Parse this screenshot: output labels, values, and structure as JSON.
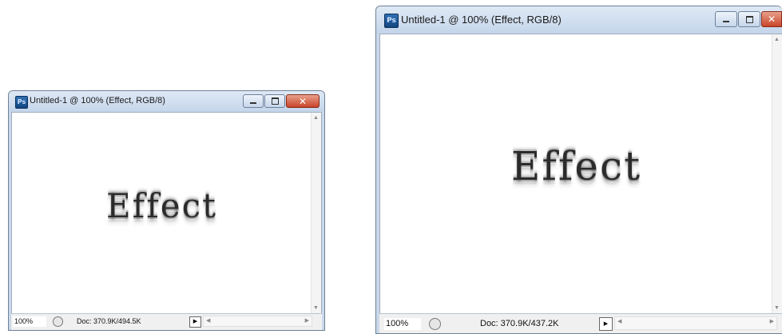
{
  "windows": [
    {
      "title": "Untitled-1 @ 100% (Effect, RGB/8)",
      "app_badge": "Ps",
      "canvas_text": "Effect",
      "zoom": "100%",
      "doc_info": "Doc: 370.9K/494.5K"
    },
    {
      "title": "Untitled-1 @ 100% (Effect, RGB/8)",
      "app_badge": "Ps",
      "canvas_text": "Effect",
      "zoom": "100%",
      "doc_info": "Doc: 370.9K/437.2K"
    }
  ],
  "icons": {
    "app": "photoshop-icon",
    "minimize": "minimize-icon",
    "maximize": "maximize-icon",
    "close": "close-icon",
    "status": "status-icon",
    "menu_arrow": "triangle-right-icon"
  },
  "colors": {
    "titlebar": "#c9d8ea",
    "close_button": "#c8452a",
    "canvas": "#ffffff"
  }
}
